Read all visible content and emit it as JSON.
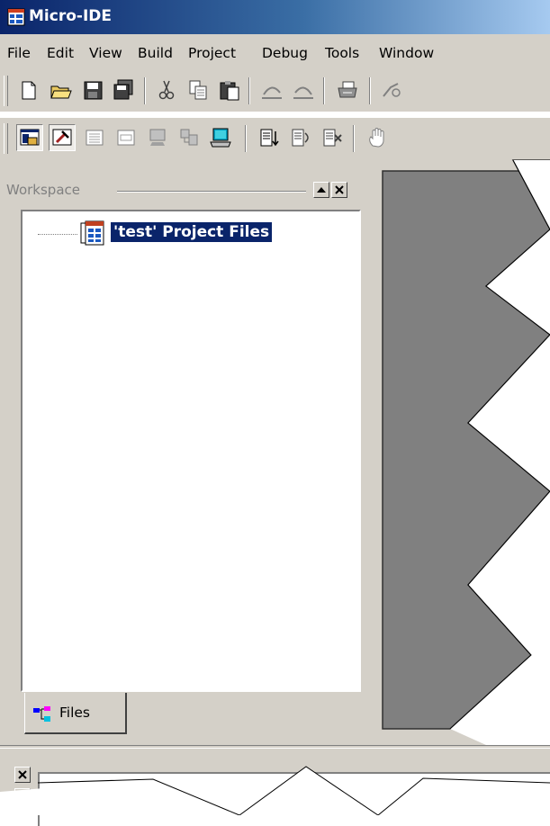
{
  "window": {
    "title": "Micro-IDE",
    "app_icon": "ide-app-icon"
  },
  "menu": [
    {
      "label": "File"
    },
    {
      "label": "Edit"
    },
    {
      "label": "View"
    },
    {
      "label": "Build"
    },
    {
      "label": "Project"
    },
    {
      "label": "Debug"
    },
    {
      "label": "Tools"
    },
    {
      "label": "Window"
    }
  ],
  "toolbar1": [
    "new-file-icon",
    "open-folder-icon",
    "save-icon",
    "save-all-icon",
    "cut-icon",
    "copy-icon",
    "paste-icon",
    "undo-icon",
    "redo-icon",
    "print-icon",
    "find-icon"
  ],
  "toolbar2": [
    "workspace-toggle-icon",
    "build-icon",
    "output-window-icon",
    "register-window-icon",
    "memory-window-icon",
    "watch-window-icon",
    "terminal-icon",
    "step-into-icon",
    "step-over-icon",
    "step-out-icon",
    "hand-icon"
  ],
  "workspace": {
    "caption": "Workspace",
    "tree": {
      "project_label": "'test' Project Files",
      "project_icon": "project-files-icon",
      "selected": true
    },
    "tabs": [
      {
        "label": "Files",
        "icon": "files-tab-icon"
      }
    ]
  },
  "colors": {
    "selection": "#0a246a",
    "mdi_background": "#808080",
    "face": "#d4d0c8",
    "title_start": "#0a246a"
  }
}
